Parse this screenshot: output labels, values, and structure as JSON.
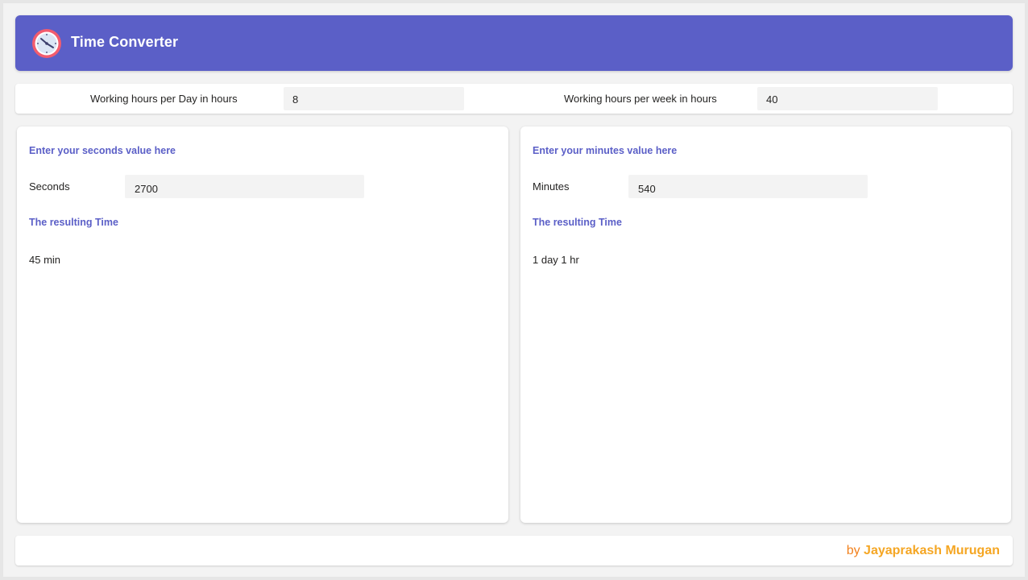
{
  "app": {
    "title": "Time Converter",
    "icon": "alarm-clock-icon",
    "accent_color": "#5b5fc7"
  },
  "settings": {
    "day_label": "Working hours per Day in hours",
    "day_value": "8",
    "week_label": "Working hours per week in hours",
    "week_value": "40"
  },
  "seconds_panel": {
    "heading": "Enter your seconds value here",
    "field_label": "Seconds",
    "field_value": "2700",
    "result_heading": "The resulting Time",
    "result_value": "45 min"
  },
  "minutes_panel": {
    "heading": "Enter your minutes value here",
    "field_label": "Minutes",
    "field_value": "540",
    "result_heading": "The resulting Time",
    "result_value": "1 day 1 hr"
  },
  "footer": {
    "by": "by",
    "author": "Jayaprakash Murugan",
    "author_color": "#f5a623"
  }
}
